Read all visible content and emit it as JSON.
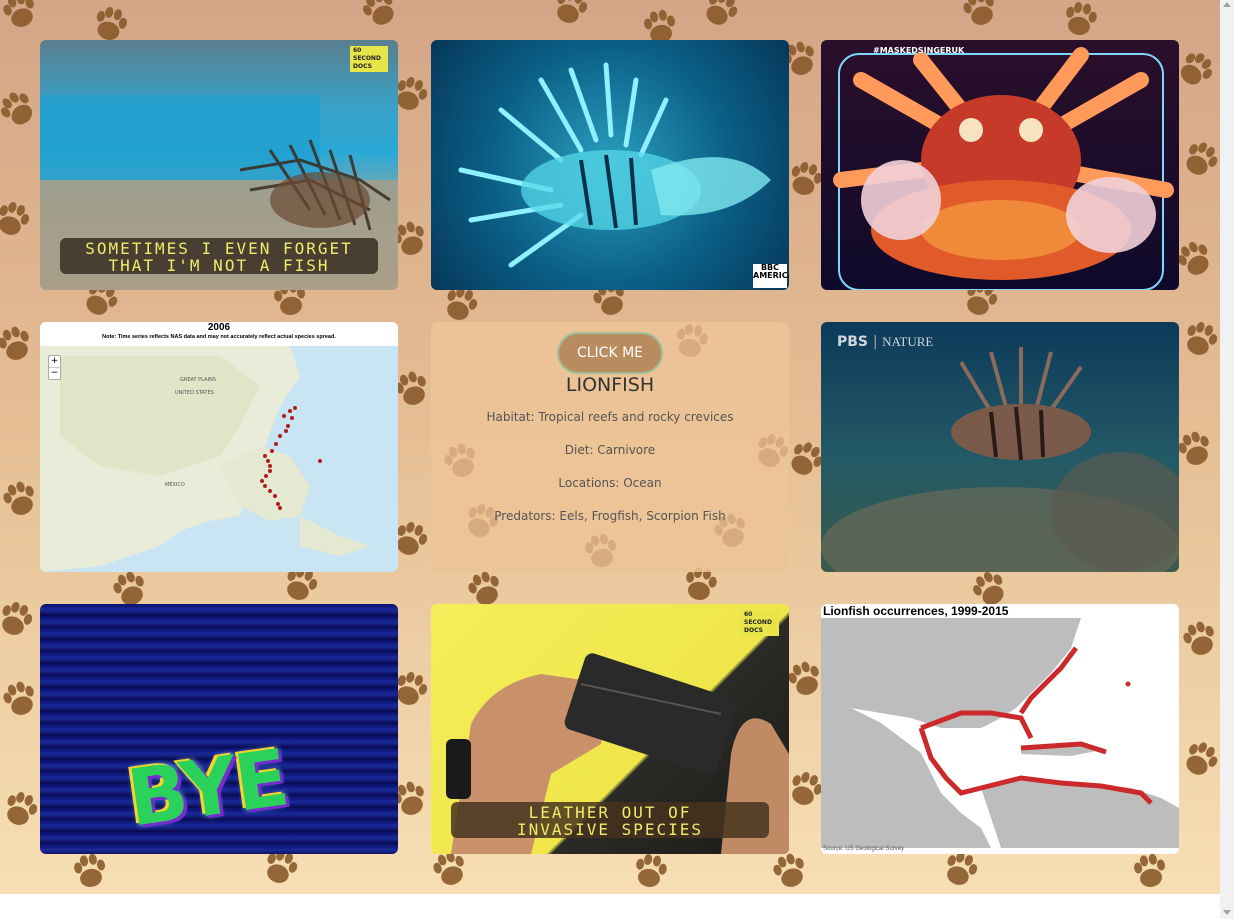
{
  "colors": {
    "page_bg_top": "#d4a587",
    "page_bg_bottom": "#f7dfb3",
    "paw": "#8a5a2b",
    "button": "#b98c5f",
    "button_border": "#9dbf9a",
    "map_red": "#cc2a2a"
  },
  "gallery": {
    "card1": {
      "caption_line1": "SOMETIMES I EVEN FORGET",
      "caption_line2": "THAT I'M NOT A FISH",
      "badge": "60 SECOND DOCS"
    },
    "card2": {
      "badge": "BBC AMERICA"
    },
    "card3": {
      "hashtag": "#MASKEDSINGERUK"
    },
    "card4": {
      "year": "2006",
      "note": "Note: Time series reflects NAS data and may not accurately reflect actual species spread.",
      "zoom_in": "+",
      "zoom_out": "−",
      "label_great_plains": "GREAT PLAINS",
      "label_united_states": "UNITED STATES",
      "label_mexico": "MÉXICO"
    },
    "card5": {
      "button_label": "CLICK ME",
      "title": "LIONFISH",
      "habitat": "Habitat: Tropical reefs and rocky crevices",
      "diet": "Diet: Carnivore",
      "locations": "Locations: Ocean",
      "predators": "Predators: Eels, Frogfish, Scorpion Fish"
    },
    "card6": {
      "logo_left": "PBS",
      "logo_right": "NATURE"
    },
    "card7": {
      "text": "BYE"
    },
    "card8": {
      "caption_line1": "LEATHER OUT OF",
      "caption_line2": "INVASIVE SPECIES",
      "badge": "60 SECOND DOCS"
    },
    "card9": {
      "title": "Lionfish occurrences, 1999-2015",
      "source": "Source: US Geological Survey"
    }
  }
}
